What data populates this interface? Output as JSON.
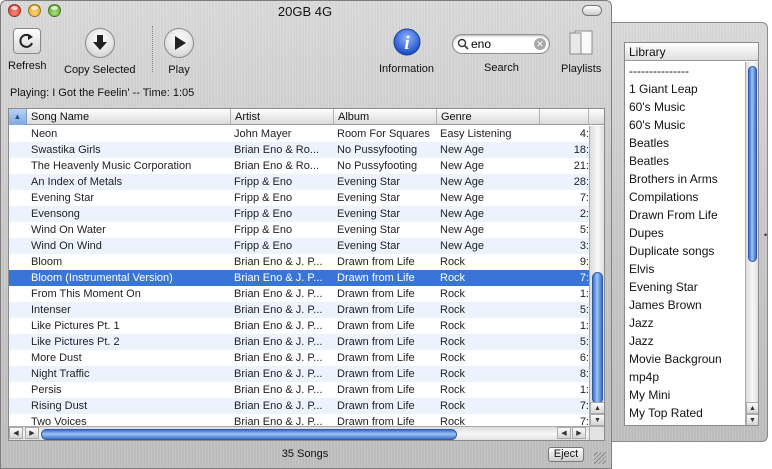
{
  "window": {
    "title": "20GB 4G"
  },
  "toolbar": {
    "refresh_label": "Refresh",
    "copy_label": "Copy Selected",
    "play_label": "Play",
    "info_label": "Information",
    "search_label": "Search",
    "playlists_label": "Playlists"
  },
  "search": {
    "value": "eno"
  },
  "status": {
    "now_playing": "Playing: I Got the Feelin' -- Time: 1:05"
  },
  "table": {
    "columns": [
      "Song Name",
      "Artist",
      "Album",
      "Genre"
    ],
    "rows": [
      {
        "name": "Neon",
        "artist": "John Mayer",
        "album": "Room For Squares",
        "genre": "Easy Listening",
        "time": "4:"
      },
      {
        "name": "Swastika Girls",
        "artist": "Brian Eno & Ro...",
        "album": "No Pussyfooting",
        "genre": "New Age",
        "time": "18:"
      },
      {
        "name": "The Heavenly Music Corporation",
        "artist": "Brian Eno & Ro...",
        "album": "No Pussyfooting",
        "genre": "New Age",
        "time": "21:"
      },
      {
        "name": "An Index of Metals",
        "artist": "Fripp & Eno",
        "album": "Evening Star",
        "genre": "New Age",
        "time": "28:"
      },
      {
        "name": "Evening Star",
        "artist": "Fripp & Eno",
        "album": "Evening Star",
        "genre": "New Age",
        "time": "7:"
      },
      {
        "name": "Evensong",
        "artist": "Fripp & Eno",
        "album": "Evening Star",
        "genre": "New Age",
        "time": "2:"
      },
      {
        "name": "Wind On Water",
        "artist": "Fripp & Eno",
        "album": "Evening Star",
        "genre": "New Age",
        "time": "5:"
      },
      {
        "name": "Wind On Wind",
        "artist": "Fripp & Eno",
        "album": "Evening Star",
        "genre": "New Age",
        "time": "3:"
      },
      {
        "name": "Bloom",
        "artist": "Brian Eno & J. P...",
        "album": "Drawn from Life",
        "genre": "Rock",
        "time": "9:"
      },
      {
        "name": "Bloom (Instrumental Version)",
        "artist": "Brian Eno & J. P...",
        "album": "Drawn from Life",
        "genre": "Rock",
        "time": "7:"
      },
      {
        "name": "From This Moment On",
        "artist": "Brian Eno & J. P...",
        "album": "Drawn from Life",
        "genre": "Rock",
        "time": "1:"
      },
      {
        "name": "Intenser",
        "artist": "Brian Eno & J. P...",
        "album": "Drawn from Life",
        "genre": "Rock",
        "time": "5:"
      },
      {
        "name": "Like Pictures Pt. 1",
        "artist": "Brian Eno & J. P...",
        "album": "Drawn from Life",
        "genre": "Rock",
        "time": "1:"
      },
      {
        "name": "Like Pictures Pt. 2",
        "artist": "Brian Eno & J. P...",
        "album": "Drawn from Life",
        "genre": "Rock",
        "time": "5:"
      },
      {
        "name": "More Dust",
        "artist": "Brian Eno & J. P...",
        "album": "Drawn from Life",
        "genre": "Rock",
        "time": "6:"
      },
      {
        "name": "Night Traffic",
        "artist": "Brian Eno & J. P...",
        "album": "Drawn from Life",
        "genre": "Rock",
        "time": "8:"
      },
      {
        "name": "Persis",
        "artist": "Brian Eno & J. P...",
        "album": "Drawn from Life",
        "genre": "Rock",
        "time": "1:"
      },
      {
        "name": "Rising Dust",
        "artist": "Brian Eno & J. P...",
        "album": "Drawn from Life",
        "genre": "Rock",
        "time": "7:"
      },
      {
        "name": "Two Voices",
        "artist": "Brian Eno & J. P...",
        "album": "Drawn from Life",
        "genre": "Rock",
        "time": "7:"
      }
    ],
    "selected_index": 9
  },
  "footer": {
    "song_count": "35 Songs",
    "eject_label": "Eject"
  },
  "drawer": {
    "header": "Library",
    "items": [
      "---------------",
      "1 Giant Leap",
      "60's Music",
      "60's Music",
      "Beatles",
      "Beatles",
      "Brothers in Arms",
      "Compilations",
      "Drawn From Life",
      "Dupes",
      "Duplicate songs",
      "Elvis",
      "Evening Star",
      "James Brown",
      "Jazz",
      "Jazz",
      "Movie Backgroun",
      "mp4p",
      "My Mini",
      "My Top Rated"
    ]
  },
  "icons": {
    "refresh": "refresh-icon",
    "copy": "download-arrow-icon",
    "play": "play-icon",
    "info": "info-icon",
    "search": "magnifier-icon",
    "playlists": "playlists-icon"
  },
  "colors": {
    "selection": "#3875d7",
    "info_blue": "#2a5bd7",
    "scroll_thumb": "#5b8fe0"
  }
}
